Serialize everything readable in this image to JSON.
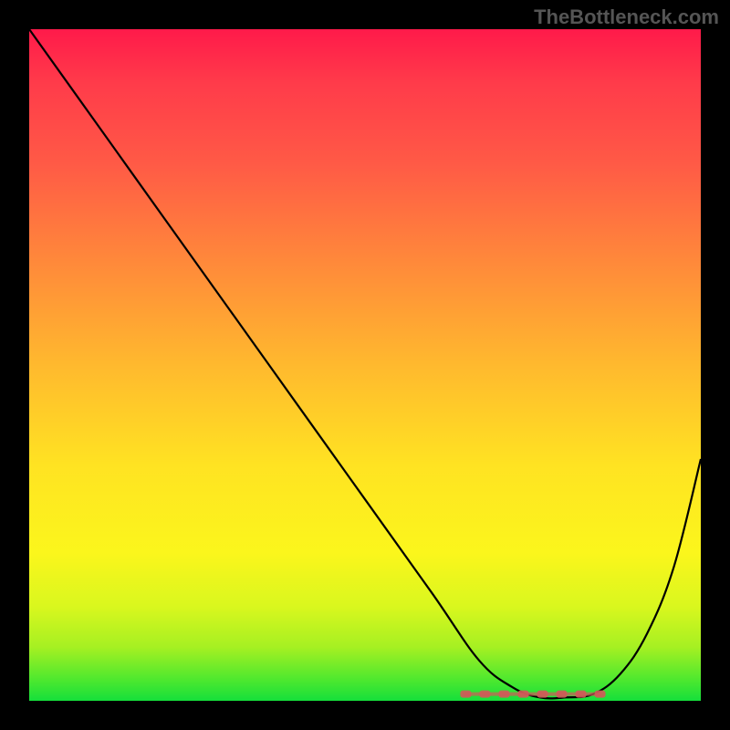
{
  "watermark": "TheBottleneck.com",
  "chart_data": {
    "type": "line",
    "title": "",
    "xlabel": "",
    "ylabel": "",
    "xlim": [
      0,
      100
    ],
    "ylim": [
      0,
      100
    ],
    "grid": false,
    "legend": false,
    "series": [
      {
        "name": "curve",
        "x": [
          0,
          10,
          20,
          30,
          40,
          50,
          60,
          67,
          72,
          76,
          80,
          84,
          88,
          92,
          96,
          100
        ],
        "y": [
          100,
          86,
          72,
          58,
          44,
          30,
          16,
          6,
          2,
          0.5,
          0.5,
          1.0,
          4,
          10,
          20,
          36
        ],
        "color": "#000000"
      }
    ],
    "annotations": [
      {
        "name": "valley-marker",
        "type": "marker-band",
        "color": "#d15a5a",
        "x_range": [
          65,
          85
        ],
        "y": 1
      }
    ]
  }
}
